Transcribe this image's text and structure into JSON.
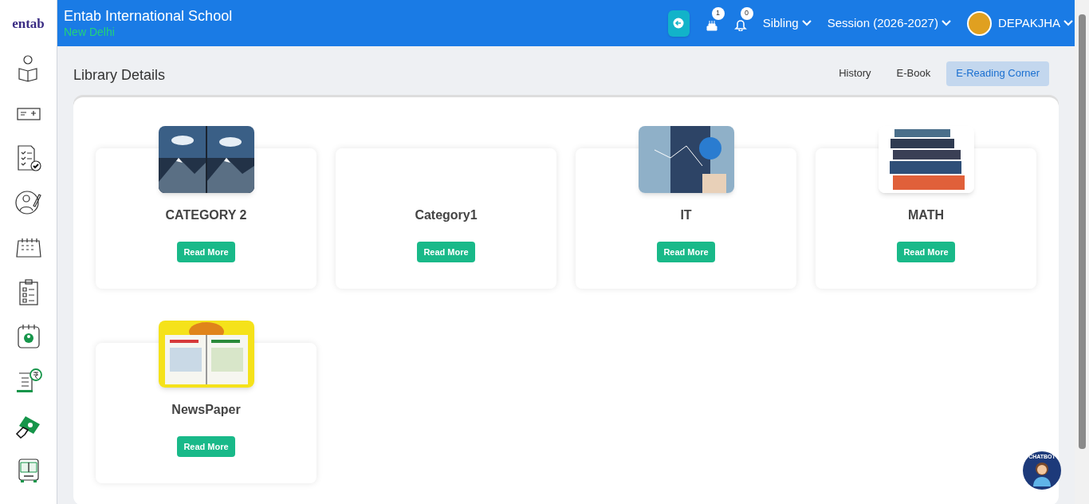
{
  "header": {
    "logo": "entab",
    "school": "Entab International School",
    "city": "New Delhi",
    "badges": [
      {
        "kind": "birthday",
        "count": "1"
      },
      {
        "kind": "bell",
        "count": "0"
      }
    ],
    "menus": [
      "Sibling",
      "Session (2026-2027)"
    ],
    "user": "DEPAKJHA"
  },
  "page": {
    "title": "Library Details",
    "tabs": [
      {
        "label": "History",
        "selected": false
      },
      {
        "label": "E-Book",
        "selected": false
      },
      {
        "label": "E-Reading Corner",
        "selected": true
      }
    ]
  },
  "categories": [
    {
      "name": "CATEGORY 2",
      "kind": "picture",
      "button": "Read More"
    },
    {
      "name": "Category1",
      "button": "Read More"
    },
    {
      "name": "IT",
      "kind": "picture",
      "button": "Read More"
    },
    {
      "name": "MATH",
      "kind": "picture",
      "button": "Read More"
    },
    {
      "name": "NewsPaper",
      "kind": "picture",
      "button": "Read More"
    }
  ],
  "chatbot": "CHATBOT"
}
